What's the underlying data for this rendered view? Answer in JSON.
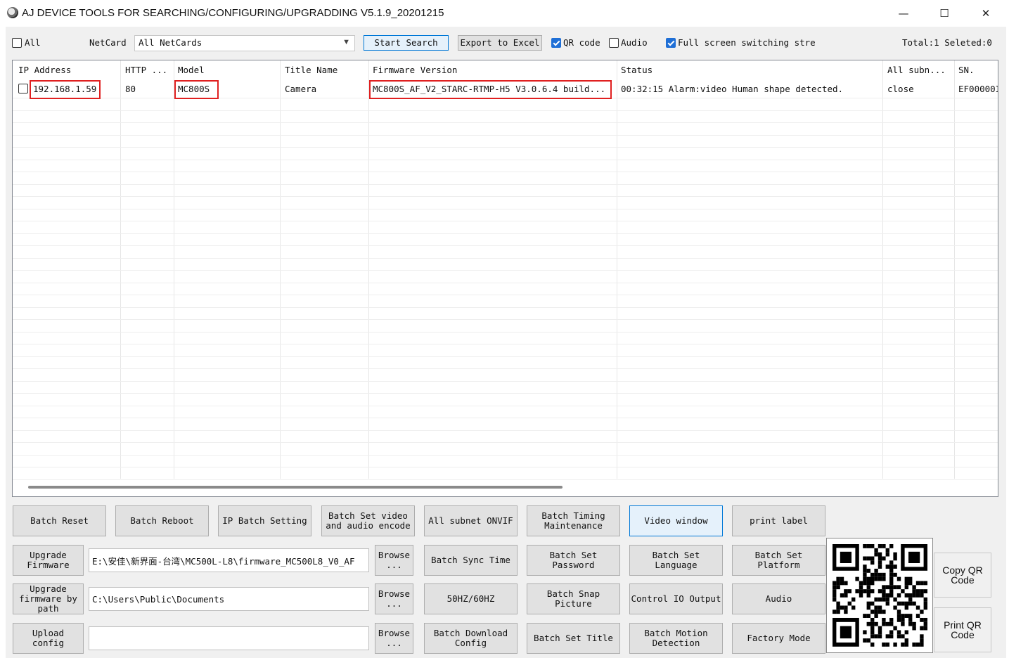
{
  "window": {
    "title": "AJ DEVICE TOOLS FOR SEARCHING/CONFIGURING/UPGRADDING V5.1.9_20201215",
    "minimize": "—",
    "maximize": "☐",
    "close": "✕"
  },
  "toolbar": {
    "all_label": "All",
    "netcard_label": "NetCard",
    "netcard_value": "All NetCards",
    "start_search": "Start Search",
    "export_excel": "Export to Excel",
    "qr_code_label": "QR code",
    "qr_code_checked": true,
    "audio_label": "Audio",
    "audio_checked": false,
    "fullscreen_label": "Full screen switching stre",
    "fullscreen_checked": true,
    "total": "Total:1 Seleted:0"
  },
  "table": {
    "columns": [
      "IP Address",
      "HTTP ...",
      "Model",
      "Title Name",
      "Firmware Version",
      "Status",
      "All subn...",
      "SN."
    ],
    "rows": [
      {
        "ip": "192.168.1.59",
        "http": "80",
        "model": "MC800S",
        "title": "Camera",
        "firmware": "MC800S_AF_V2_STARC-RTMP-H5 V3.0.6.4 build...",
        "status": "00:32:15 Alarm:video Human shape detected.",
        "subnet": "close",
        "sn": "EF00000I"
      }
    ]
  },
  "buttons": {
    "batch_reset": "Batch Reset",
    "batch_reboot": "Batch Reboot",
    "ip_batch_setting": "IP Batch Setting",
    "batch_video_audio": "Batch Set video\nand audio encode",
    "all_subnet_onvif": "All subnet ONVIF",
    "batch_timing": "Batch Timing\nMaintenance",
    "video_window": "Video window",
    "print_label": "print label",
    "upgrade_firmware": "Upgrade\nFirmware",
    "browse1": "Browse\n...",
    "batch_sync_time": "Batch Sync Time",
    "batch_set_password": "Batch Set\nPassword",
    "batch_set_language": "Batch Set\nLanguage",
    "batch_set_platform": "Batch Set\nPlatform",
    "upgrade_by_path": "Upgrade\nfirmware by\npath",
    "browse2": "Browse\n...",
    "hz": "50HZ/60HZ",
    "batch_snap": "Batch Snap\nPicture",
    "control_io": "Control IO Output",
    "audio": "Audio",
    "upload_config": "Upload\nconfig",
    "browse3": "Browse\n...",
    "batch_download_config": "Batch Download\nConfig",
    "batch_set_title": "Batch Set Title",
    "batch_motion": "Batch Motion\nDetection",
    "factory_mode": "Factory Mode",
    "copy_qr": "Copy QR\nCode",
    "print_qr": "Print QR\nCode"
  },
  "paths": {
    "firmware_path": "E:\\安佳\\新界面-台湾\\MC500L-L8\\firmware_MC500L8_V0_AF",
    "upgrade_path": "C:\\Users\\Public\\Documents",
    "config_path": ""
  },
  "icons": {
    "app": "magnifier-camera-icon",
    "qr": "qr-code-icon"
  },
  "colors": {
    "highlight": "#e02020",
    "accent": "#1f6fd6"
  }
}
